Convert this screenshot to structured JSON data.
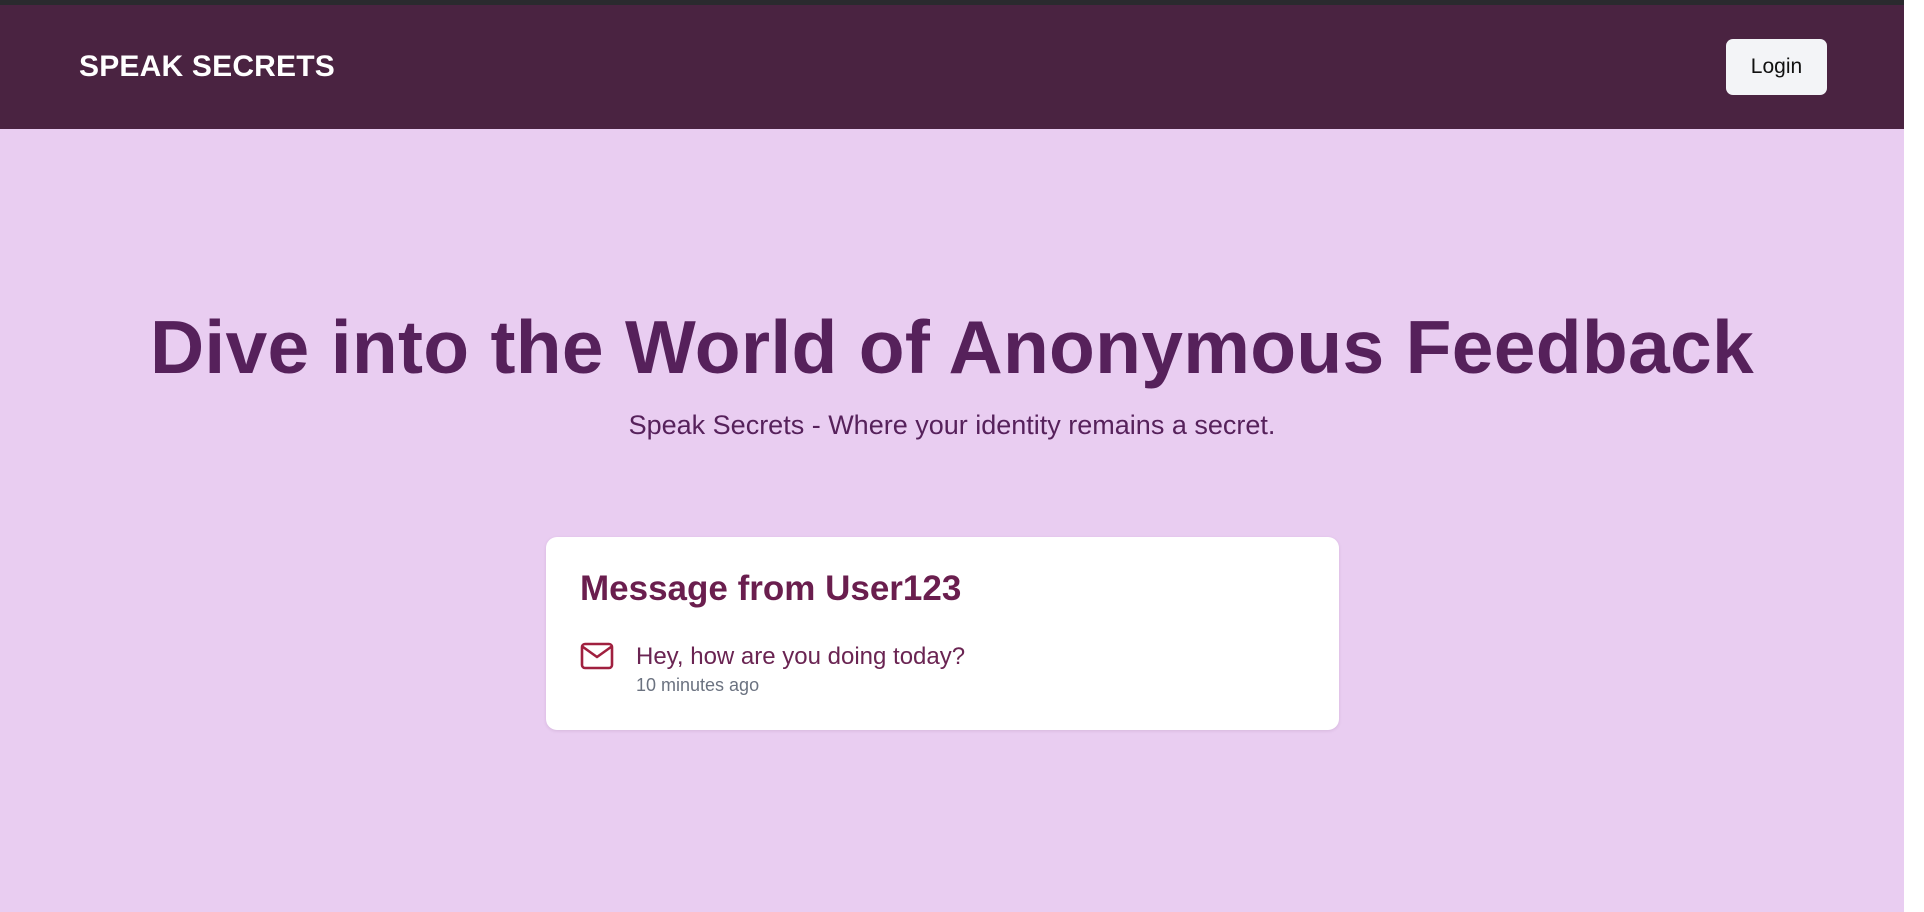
{
  "header": {
    "brand": "SPEAK SECRETS",
    "login_label": "Login"
  },
  "hero": {
    "title": "Dive into the World of Anonymous Feedback",
    "subtitle": "Speak Secrets - Where your identity remains a secret."
  },
  "message_card": {
    "title": "Message from User123",
    "icon": "mail-icon",
    "text": "Hey, how are you doing today?",
    "time": "10 minutes ago"
  },
  "colors": {
    "navbar_bg": "#4a2341",
    "page_bg": "#e9cdf1",
    "heading": "#56215b",
    "card_title": "#6a1e4e",
    "icon": "#a0203f"
  }
}
